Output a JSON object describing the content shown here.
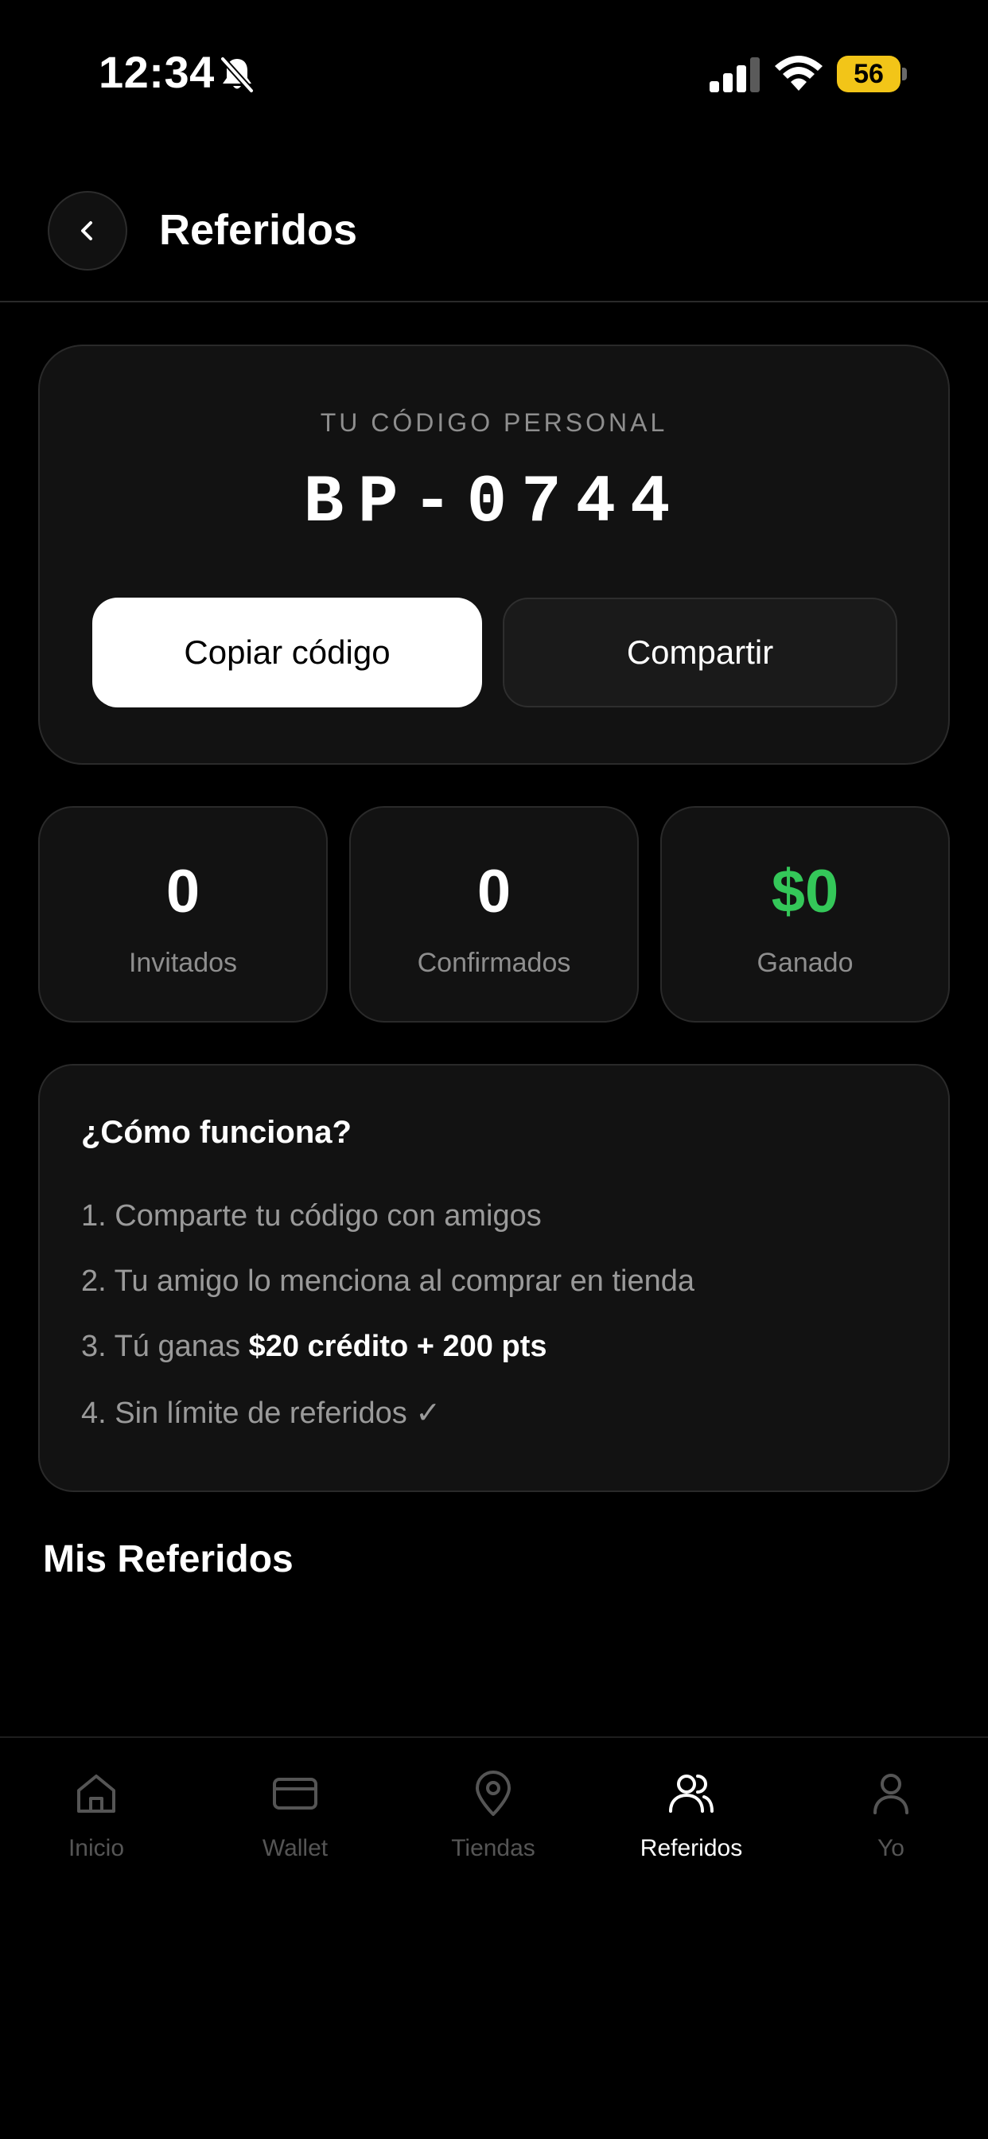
{
  "status_bar": {
    "time": "12:34",
    "battery": "56",
    "icons": [
      "bell-slash-icon",
      "cellular-signal-icon",
      "wifi-icon",
      "battery-icon"
    ]
  },
  "header": {
    "title": "Referidos",
    "back_icon": "chevron-left-icon"
  },
  "code_card": {
    "label": "TU CÓDIGO PERSONAL",
    "code": "BP-0744",
    "copy_label": "Copiar código",
    "share_label": "Compartir"
  },
  "stats": [
    {
      "value": "0",
      "label": "Invitados"
    },
    {
      "value": "0",
      "label": "Confirmados"
    },
    {
      "value": "$0",
      "label": "Ganado"
    }
  ],
  "how_it_works": {
    "title": "¿Cómo funciona?",
    "steps": [
      {
        "text": "1. Comparte tu código con amigos"
      },
      {
        "text": "2. Tu amigo lo menciona al comprar en tienda"
      },
      {
        "prefix": "3. Tú ganas ",
        "highlight": "$20 crédito + 200 pts"
      },
      {
        "text": "4. Sin límite de referidos ✓"
      }
    ]
  },
  "referrals_section": {
    "title": "Mis Referidos"
  },
  "bottom_nav": {
    "items": [
      {
        "label": "Inicio",
        "icon": "home-icon"
      },
      {
        "label": "Wallet",
        "icon": "card-icon"
      },
      {
        "label": "Tiendas",
        "icon": "map-pin-icon"
      },
      {
        "label": "Referidos",
        "icon": "users-icon",
        "active": true
      },
      {
        "label": "Yo",
        "icon": "user-icon"
      }
    ]
  },
  "colors": {
    "background": "#000000",
    "card": "#121212",
    "accent_green": "#34c759",
    "battery": "#f2c518"
  }
}
